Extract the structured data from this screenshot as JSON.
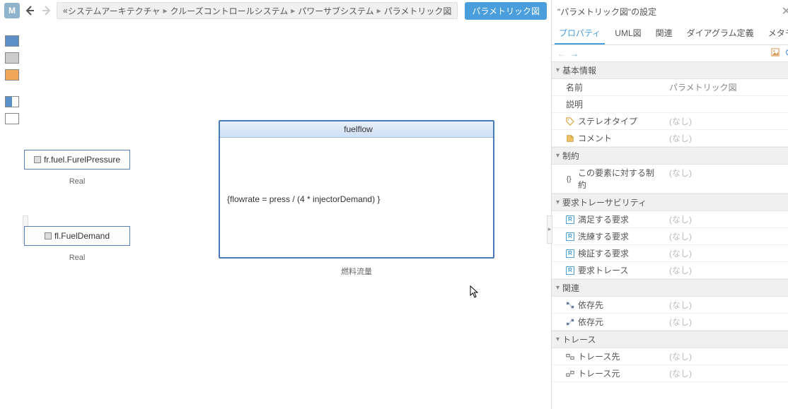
{
  "topbar": {
    "m_label": "M",
    "breadcrumbs": [
      "システムアーキテクチャ",
      "クルーズコントロールシステム",
      "パワーサブシステム",
      "パラメトリック図"
    ],
    "prefix": "«",
    "tag_button": "パラメトリック図"
  },
  "canvas": {
    "block1": {
      "label": "fr.fuel.FurelPressure",
      "type": "Real"
    },
    "block2": {
      "label": "fl.FuelDemand",
      "type": "Real"
    },
    "fuelflow": {
      "title": "fuelflow",
      "expr": "{flowrate = press / (4 * injectorDemand) }",
      "caption": "燃料流量"
    }
  },
  "panel": {
    "title": "\"パラメトリック図\"の設定",
    "tabs": [
      "プロパティ",
      "UML図",
      "関連",
      "ダイアグラム定義",
      "メタモデル"
    ],
    "none": "(なし)",
    "sections": {
      "basic": {
        "header": "基本情報",
        "name_label": "名前",
        "name_value": "パラメトリック図",
        "desc_label": "説明",
        "stereo_label": "ステレオタイプ",
        "comment_label": "コメント"
      },
      "constraint": {
        "header": "制約",
        "item": "この要素に対する制約"
      },
      "trace_req": {
        "header": "要求トレーサビリティ",
        "satisfy": "満足する要求",
        "refine": "洗練する要求",
        "verify": "検証する要求",
        "trace": "要求トレース"
      },
      "relation": {
        "header": "関連",
        "dep_to": "依存先",
        "dep_from": "依存元"
      },
      "trace": {
        "header": "トレース",
        "to": "トレース先",
        "from": "トレース元"
      }
    }
  }
}
